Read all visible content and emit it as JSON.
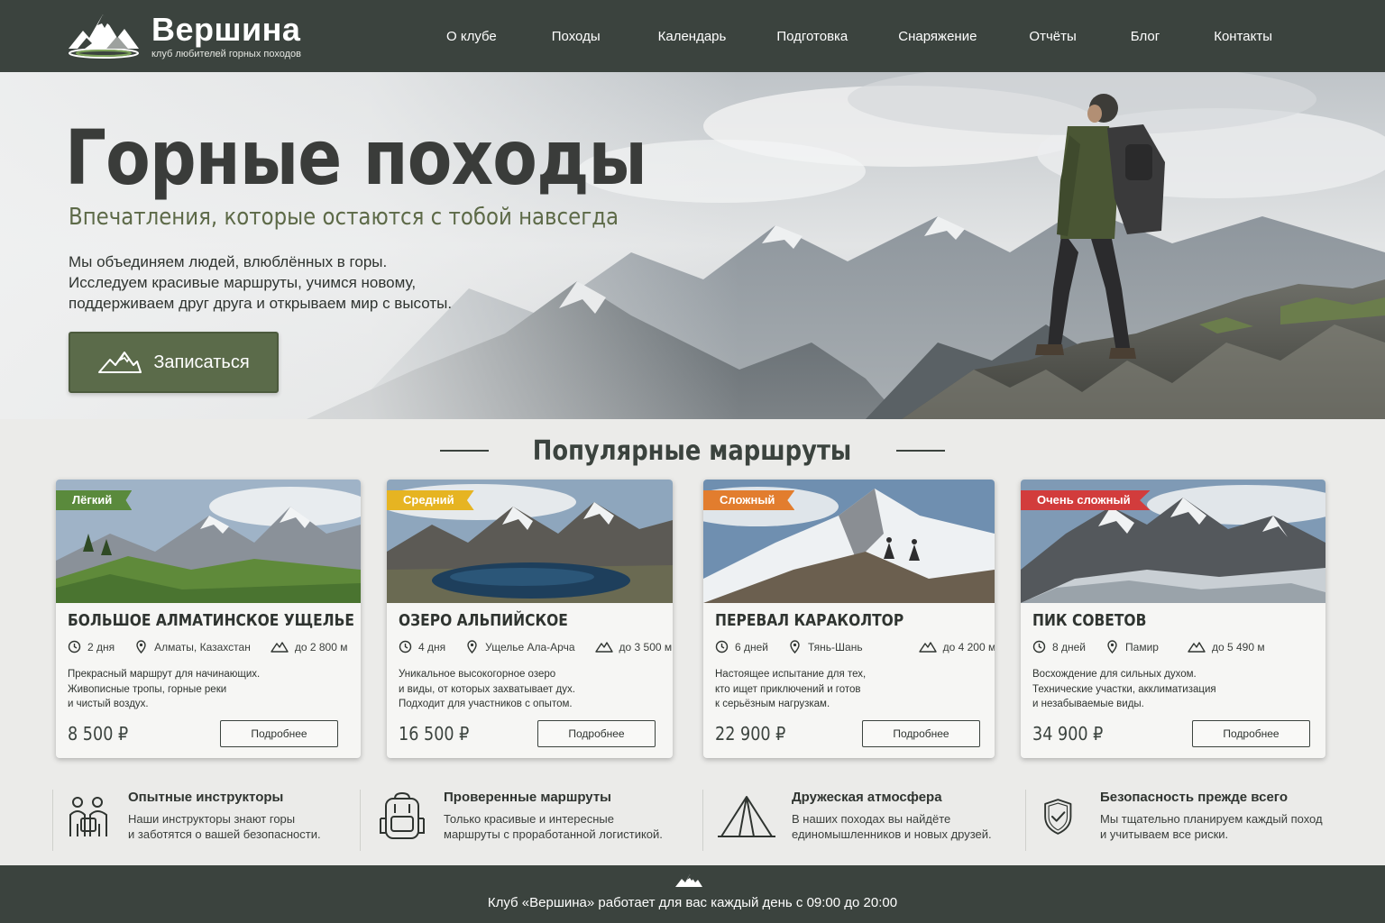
{
  "brand": {
    "name": "Вершина",
    "tagline": "клуб любителей горных походов"
  },
  "nav": [
    {
      "label": "О клубе"
    },
    {
      "label": "Походы"
    },
    {
      "label": "Календарь"
    },
    {
      "label": "Подготовка"
    },
    {
      "label": "Снаряжение"
    },
    {
      "label": "Отчёты"
    },
    {
      "label": "Блог"
    },
    {
      "label": "Контакты"
    }
  ],
  "hero": {
    "title": "Горные походы",
    "subtitle": "Впечатления, которые остаются с тобой навсегда",
    "text": [
      "Мы объединяем людей, влюблённых в горы.",
      "Исследуем красивые маршруты, учимся новому,",
      "поддерживаем друг друга и открываем мир с высоты."
    ],
    "cta_label": "Записаться"
  },
  "routes_section": {
    "title": "Популярные маршруты"
  },
  "routes": [
    {
      "badge": "Лёгкий",
      "badge_color": "#5a8a3c",
      "title": "БОЛЬШОЕ АЛМАТИНСКОЕ УЩЕЛЬЕ",
      "duration": "2 дня",
      "location": "Алматы, Казахстан",
      "altitude": "до 2 800 м",
      "desc": [
        "Прекрасный маршрут для начинающих.",
        "Живописные тропы, горные реки",
        "и чистый воздух."
      ],
      "price": "8 500 ₽",
      "button": "Подробнее"
    },
    {
      "badge": "Средний",
      "badge_color": "#e6b422",
      "title": "ОЗЕРО АЛЬПИЙСКОЕ",
      "duration": "4 дня",
      "location": "Ущелье Ала-Арча",
      "altitude": "до 3 500 м",
      "desc": [
        "Уникальное высокогорное озеро",
        "и виды, от которых захватывает дух.",
        "Подходит для участников с опытом."
      ],
      "price": "16 500 ₽",
      "button": "Подробнее"
    },
    {
      "badge": "Сложный",
      "badge_color": "#e27d2e",
      "title": "ПЕРЕВАЛ КАРАКОЛТОР",
      "duration": "6 дней",
      "location": "Тянь-Шань",
      "altitude": "до 4 200 м",
      "desc": [
        "Настоящее испытание для тех,",
        "кто ищет приключений и готов",
        "к серьёзным нагрузкам."
      ],
      "price": "22 900 ₽",
      "button": "Подробнее"
    },
    {
      "badge": "Очень сложный",
      "badge_color": "#d23c3c",
      "title": "ПИК СОВЕТОВ",
      "duration": "8 дней",
      "location": "Памир",
      "altitude": "до 5 490 м",
      "desc": [
        "Восхождение для сильных духом.",
        "Технические участки, акклиматизация",
        "и незабываемые виды."
      ],
      "price": "34 900 ₽",
      "button": "Подробнее"
    }
  ],
  "features": [
    {
      "icon": "instructors-icon",
      "title": "Опытные инструкторы",
      "text": [
        "Наши инструкторы знают горы",
        "и заботятся о вашей безопасности."
      ]
    },
    {
      "icon": "backpack-icon",
      "title": "Проверенные маршруты",
      "text": [
        "Только красивые и интересные",
        "маршруты с проработанной логистикой."
      ]
    },
    {
      "icon": "tent-icon",
      "title": "Дружеская атмосфера",
      "text": [
        "В наших походах вы найдёте",
        "единомышленников и новых друзей."
      ]
    },
    {
      "icon": "shield-check-icon",
      "title": "Безопасность прежде всего",
      "text": [
        "Мы тщательно планируем каждый поход",
        "и учитываем все риски."
      ]
    }
  ],
  "footer": {
    "text": "Клуб «Вершина» работает для вас каждый день с 09:00 до 20:00"
  }
}
